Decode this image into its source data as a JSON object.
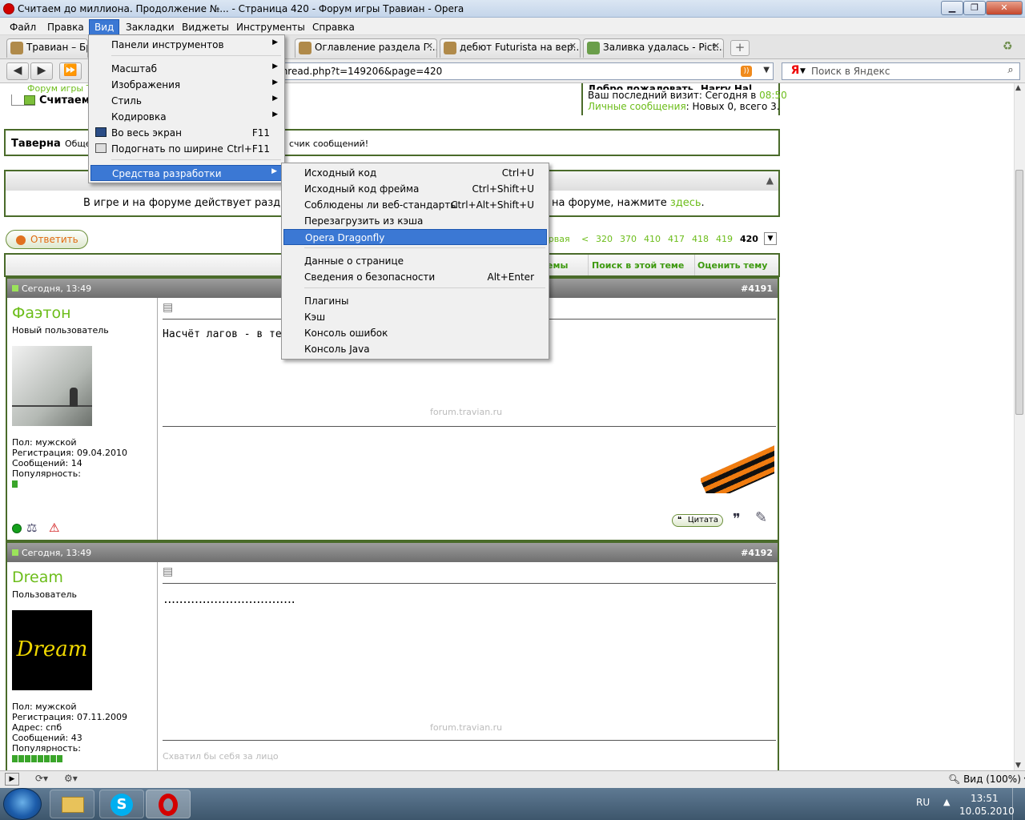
{
  "window": {
    "title": "Считаем до миллиона. Продолжение №... - Страница 420 - Форум игры Травиан - Opera"
  },
  "menubar": {
    "items": [
      "Файл",
      "Правка",
      "Вид",
      "Закладки",
      "Виджеты",
      "Инструменты",
      "Справка"
    ],
    "active": "Вид"
  },
  "tabs": [
    {
      "label": "Травиан – Бра"
    },
    {
      "label": "Оглавление раздела Г..."
    },
    {
      "label": "дебют Futurista на вер..."
    },
    {
      "label": "Заливка удалась - Pict..."
    }
  ],
  "address": {
    "url": "thread.php?t=149206&page=420"
  },
  "search": {
    "engine_glyph": "Я",
    "placeholder": "Поиск в Яндекс"
  },
  "view_menu": {
    "items": [
      {
        "label": "Панели инструментов",
        "submenu": true
      },
      {
        "label": "Масштаб",
        "submenu": true
      },
      {
        "label": "Изображения",
        "submenu": true
      },
      {
        "label": "Стиль",
        "submenu": true
      },
      {
        "label": "Кодировка",
        "submenu": true
      },
      {
        "label": "Во весь экран",
        "shortcut": "F11"
      },
      {
        "label": "Подогнать по ширине",
        "shortcut": "Ctrl+F11"
      },
      {
        "label": "Средства разработки",
        "submenu": true
      }
    ]
  },
  "devtools_menu": {
    "items": [
      {
        "label": "Исходный код",
        "shortcut": "Ctrl+U"
      },
      {
        "label": "Исходный код фрейма",
        "shortcut": "Ctrl+Shift+U"
      },
      {
        "label": "Соблюдены ли веб-стандарты",
        "shortcut": "Ctrl+Alt+Shift+U"
      },
      {
        "label": "Перезагрузить из кэша",
        "shortcut": ""
      },
      {
        "label": "Opera Dragonfly",
        "shortcut": ""
      },
      {
        "label": "Данные о странице",
        "shortcut": ""
      },
      {
        "label": "Сведения о безопасности",
        "shortcut": "Alt+Enter"
      },
      {
        "label": "Плагины",
        "shortcut": ""
      },
      {
        "label": "Кэш",
        "shortcut": ""
      },
      {
        "label": "Консоль ошибок",
        "shortcut": ""
      },
      {
        "label": "Консоль Java",
        "shortcut": ""
      }
    ]
  },
  "forum": {
    "breadcrumb_top": "Форум игры Т",
    "breadcrumb_title": "Считаем",
    "welcome": "Добро пожаловать, Harry Hal",
    "last_visit_label": "Ваш последний визит: Сегодня в",
    "last_visit_time": "08:50",
    "pm_link": "Личные сообщения",
    "pm_text": ": Новых 0, всего 3.",
    "tavern_title": "Таверна",
    "tavern_desc": "Обще",
    "tavern_desc2": "счик сообщений!",
    "notice_text": "В игре и на форуме действует разд",
    "notice_text2": "на форуме, нажмите",
    "notice_link": "здесь",
    "notice_end": ".",
    "reply_button": "Ответить",
    "pagination": [
      "ервая",
      "<",
      "320",
      "370",
      "410",
      "417",
      "418",
      "419",
      "420"
    ],
    "thread_tools": [
      "емы",
      "Поиск в этой теме",
      "Оценить тему"
    ],
    "watermark": "forum.travian.ru"
  },
  "posts": [
    {
      "date": "Сегодня, 13:49",
      "number": "#4191",
      "author": "Фаэтон",
      "rank": "Новый пользователь",
      "stats": [
        "Пол: мужской",
        "Регистрация: 09.04.2010",
        "Сообщений: 14",
        "Популярность:"
      ],
      "reputation_fill": 0.14,
      "text": "Насчёт лагов - в теме",
      "quote_button": "Цитата"
    },
    {
      "date": "Сегодня, 13:49",
      "number": "#4192",
      "author": "Dream",
      "rank": "Пользователь",
      "avatar_text": "Dream",
      "stats": [
        "Пол: мужской",
        "Регистрация: 07.11.2009",
        "Адрес: спб",
        "Сообщений: 43",
        "Популярность:"
      ],
      "reputation_fill": 1.0,
      "text": "..................................",
      "signature": "Схватил бы себя за лицо"
    }
  ],
  "statusbar": {
    "zoom": "Вид (100%)"
  },
  "taskbar": {
    "lang": "RU",
    "time": "13:51",
    "date": "10.05.2010"
  },
  "colors": {
    "forum_green": "#6cbd1a",
    "frame_green": "#4a6b2a",
    "menu_highlight": "#3b78d4"
  }
}
